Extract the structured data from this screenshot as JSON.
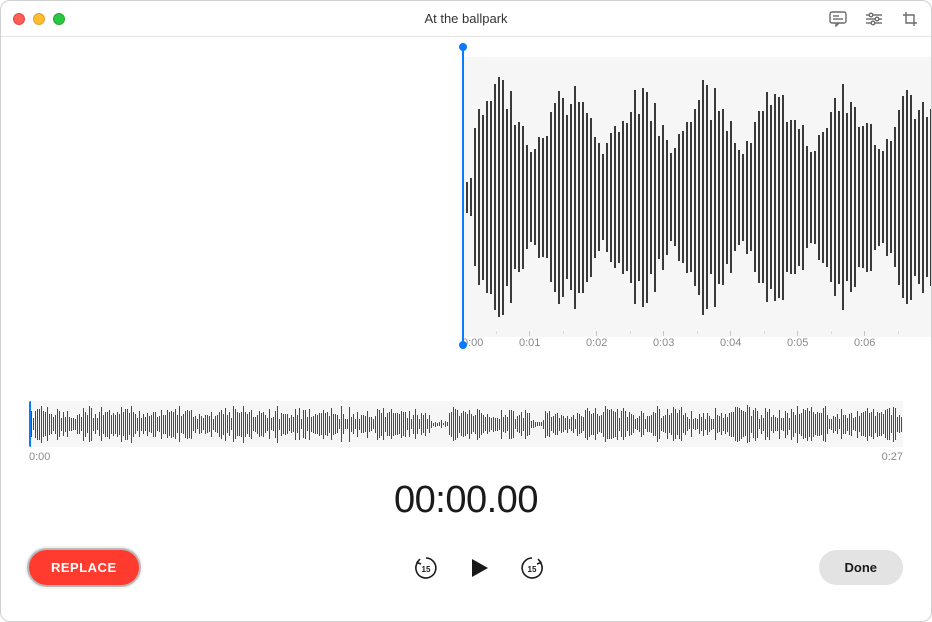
{
  "window": {
    "title": "At the ballpark"
  },
  "toolbar": {
    "transcript_icon": "transcript-icon",
    "settings_icon": "settings-icon",
    "trim_icon": "trim-icon"
  },
  "main_ruler": {
    "ticks": [
      "0:00",
      "0:01",
      "0:02",
      "0:03",
      "0:04",
      "0:05",
      "0:06"
    ]
  },
  "overview": {
    "start_time": "0:00",
    "end_time": "0:27"
  },
  "timer": "00:00.00",
  "controls": {
    "replace_label": "REPLACE",
    "skip_back_seconds": "15",
    "skip_forward_seconds": "15",
    "done_label": "Done"
  },
  "colors": {
    "accent": "#0a7aff",
    "record": "#ff3b30"
  }
}
